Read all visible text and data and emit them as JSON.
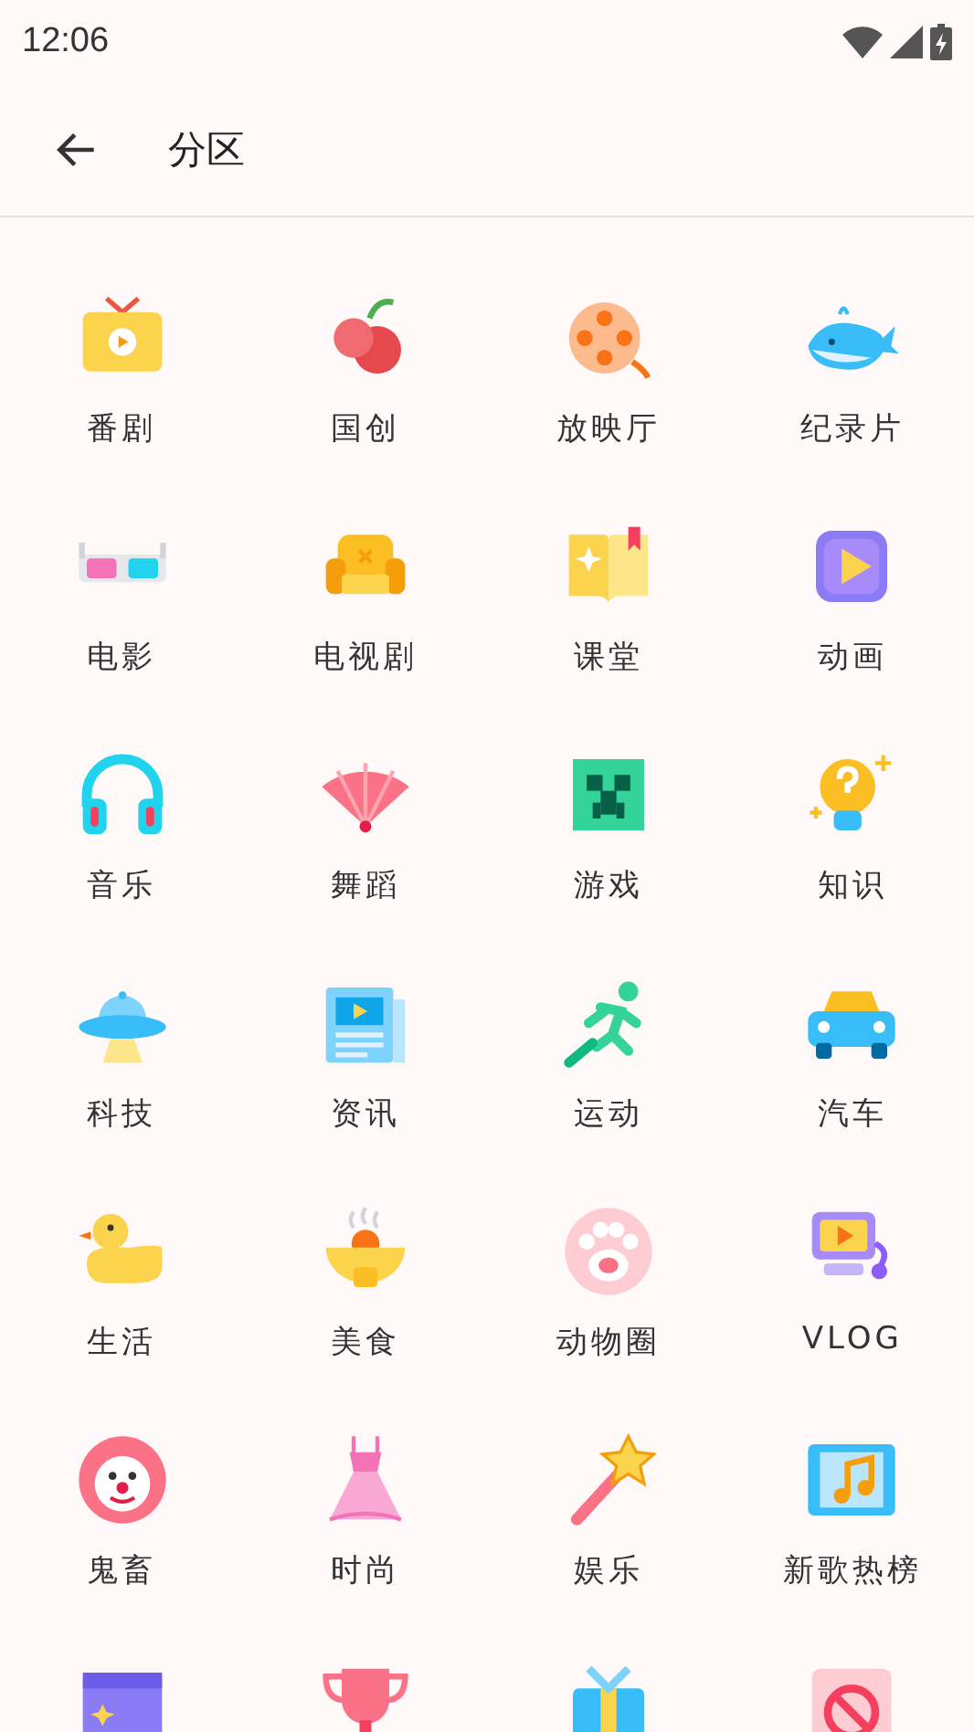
{
  "status_bar": {
    "time": "12:06"
  },
  "header": {
    "title": "分区"
  },
  "categories": [
    {
      "label": "番剧"
    },
    {
      "label": "国创"
    },
    {
      "label": "放映厅"
    },
    {
      "label": "纪录片"
    },
    {
      "label": "电影"
    },
    {
      "label": "电视剧"
    },
    {
      "label": "课堂"
    },
    {
      "label": "动画"
    },
    {
      "label": "音乐"
    },
    {
      "label": "舞蹈"
    },
    {
      "label": "游戏"
    },
    {
      "label": "知识"
    },
    {
      "label": "科技"
    },
    {
      "label": "资讯"
    },
    {
      "label": "运动"
    },
    {
      "label": "汽车"
    },
    {
      "label": "生活"
    },
    {
      "label": "美食"
    },
    {
      "label": "动物圈"
    },
    {
      "label": "VLOG"
    },
    {
      "label": "鬼畜"
    },
    {
      "label": "时尚"
    },
    {
      "label": "娱乐"
    },
    {
      "label": "新歌热榜"
    }
  ]
}
